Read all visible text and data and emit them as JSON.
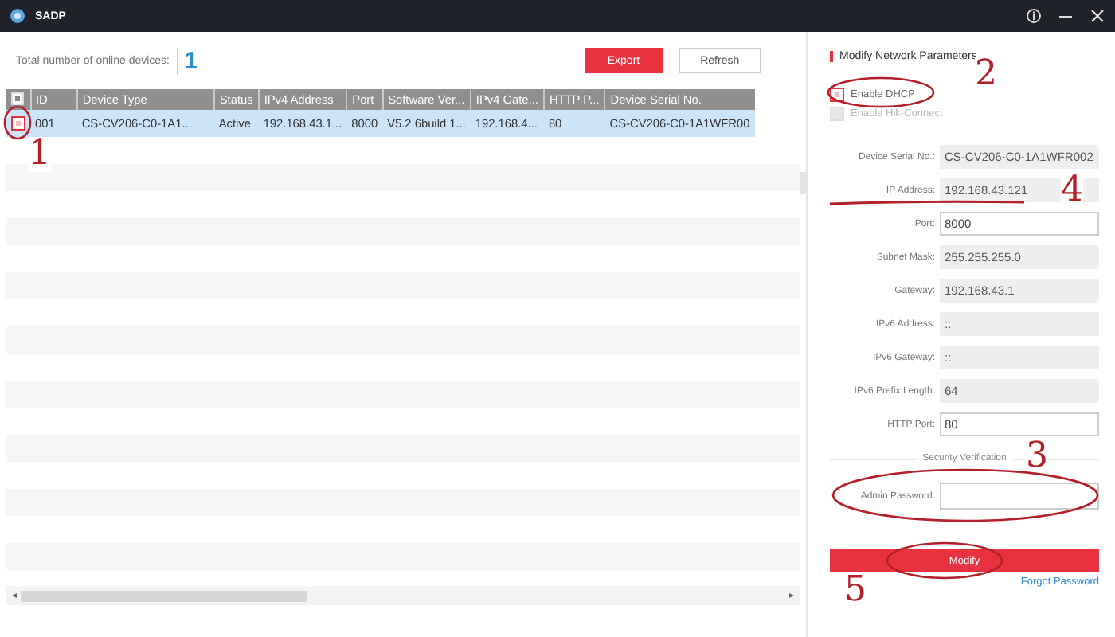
{
  "window": {
    "title": "SADP"
  },
  "toolbar": {
    "count_label": "Total number of online devices:",
    "count": "1",
    "buttons": [
      {
        "label": "Export",
        "kind": "primary"
      },
      {
        "label": "Refresh",
        "kind": "secondary"
      }
    ]
  },
  "table": {
    "columns": [
      "ID",
      "Device Type",
      "Status",
      "IPv4 Address",
      "Port",
      "Software Ver...",
      "IPv4 Gate...",
      "HTTP P...",
      "Device Serial No."
    ],
    "rows": [
      {
        "checked": true,
        "selected": true,
        "cells": [
          "001",
          "CS-CV206-C0-1A1...",
          "Active",
          "192.168.43.1...",
          "8000",
          "V5.2.6build 1...",
          "192.168.4...",
          "80",
          "CS-CV206-C0-1A1WFR00"
        ]
      }
    ]
  },
  "panel": {
    "title": "Modify Network Parameters",
    "options": [
      {
        "label": "Enable DHCP",
        "checked": true,
        "disabled": false
      },
      {
        "label": "Enable Hik-Connect",
        "checked": false,
        "disabled": true
      }
    ],
    "fields": [
      {
        "label": "Device Serial No.:",
        "value": "CS-CV206-C0-1A1WFR002",
        "disabled": true
      },
      {
        "label": "IP Address:",
        "value": "192.168.43.121",
        "disabled": true
      },
      {
        "label": "Port:",
        "value": "8000",
        "disabled": false
      },
      {
        "label": "Subnet Mask:",
        "value": "255.255.255.0",
        "disabled": true
      },
      {
        "label": "Gateway:",
        "value": "192.168.43.1",
        "disabled": true
      },
      {
        "label": "IPv6 Address:",
        "value": "::",
        "disabled": true
      },
      {
        "label": "IPv6 Gateway:",
        "value": "::",
        "disabled": true
      },
      {
        "label": "IPv6 Prefix Length:",
        "value": "64",
        "disabled": true
      },
      {
        "label": "HTTP Port:",
        "value": "80",
        "disabled": false
      }
    ],
    "security_heading": "Security Verification",
    "password_field": {
      "label": "Admin Password:"
    },
    "modify_button": "Modify",
    "forgot_link": "Forgot Password"
  },
  "annotations": [
    {
      "label": "1"
    },
    {
      "label": "2"
    },
    {
      "label": "3"
    },
    {
      "label": "4"
    },
    {
      "label": "5"
    }
  ]
}
